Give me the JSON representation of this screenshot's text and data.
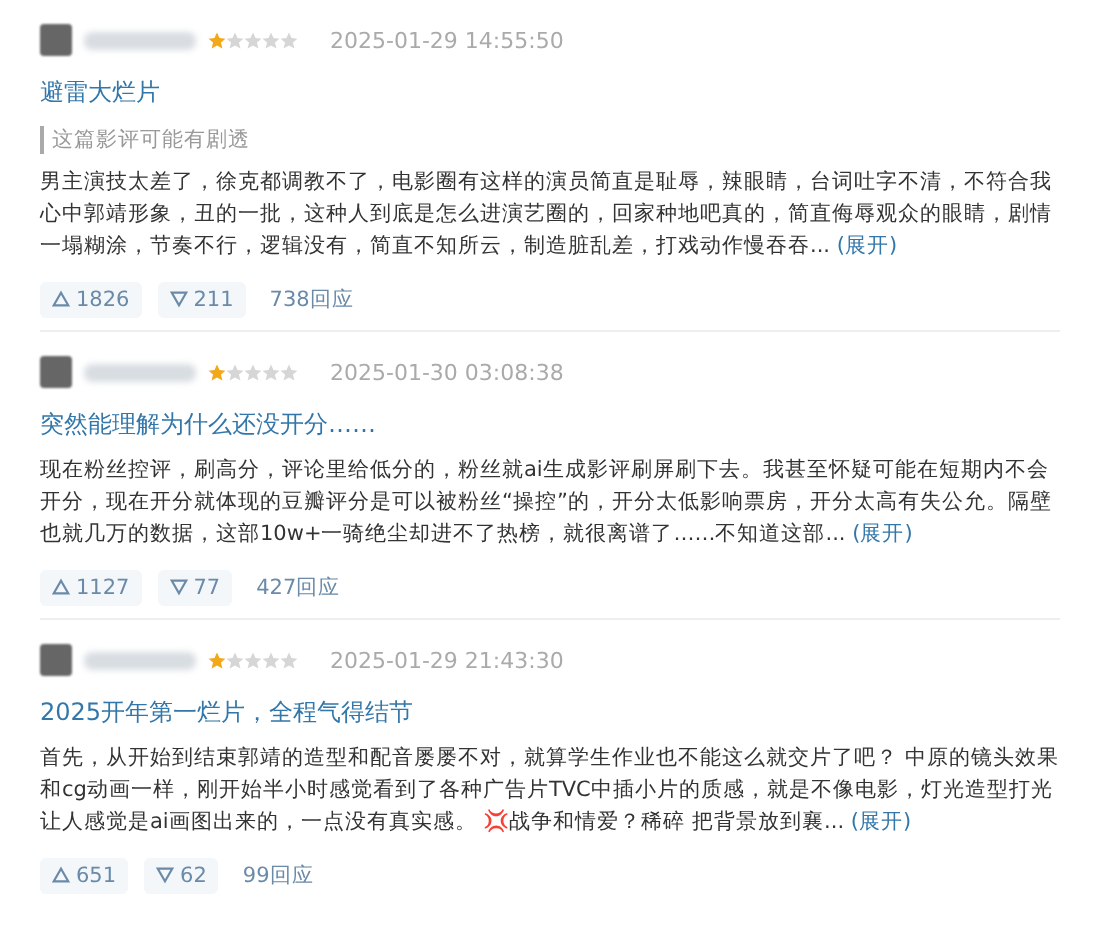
{
  "reviews": [
    {
      "stars": 1,
      "time": "2025-01-29 14:55:50",
      "title": "避雷大烂片",
      "spoiler": "这篇影评可能有剧透",
      "body": "男主演技太差了，徐克都调教不了，电影圈有这样的演员简直是耻辱，辣眼睛，台词吐字不清，不符合我心中郭靖形象，丑的一批，这种人到底是怎么进演艺圈的，回家种地吧真的，简直侮辱观众的眼睛，剧情一塌糊涂，节奏不行，逻辑没有，简直不知所云，制造脏乱差，打戏动作慢吞吞...",
      "expand": "(展开)",
      "up": "1826",
      "down": "211",
      "replies": "738回应"
    },
    {
      "stars": 1,
      "time": "2025-01-30 03:08:38",
      "title": "突然能理解为什么还没开分……",
      "body": "现在粉丝控评，刷高分，评论里给低分的，粉丝就ai生成影评刷屏刷下去。我甚至怀疑可能在短期内不会开分，现在开分就体现的豆瓣评分是可以被粉丝“操控”的，开分太低影响票房，开分太高有失公允。隔壁也就几万的数据，这部10w+一骑绝尘却进不了热榜，就很离谱了……不知道这部...",
      "expand": "(展开)",
      "up": "1127",
      "down": "77",
      "replies": "427回应"
    },
    {
      "stars": 1,
      "time": "2025-01-29 21:43:30",
      "title": "2025开年第一烂片，全程气得结节",
      "body": "首先，从开始到结束郭靖的造型和配音屡屡不对，就算学生作业也不能这么就交片了吧？ 中原的镜头效果和cg动画一样，刚开始半小时感觉看到了各种广告片TVC中插小片的质感，就是不像电影，灯光造型打光让人感觉是ai画图出来的，一点没有真实感。 💢战争和情爱？稀碎 把背景放到襄...",
      "expand": "(展开)",
      "up": "651",
      "down": "62",
      "replies": "99回应"
    }
  ]
}
